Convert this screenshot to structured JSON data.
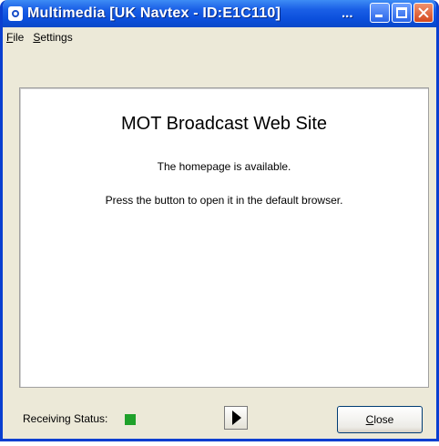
{
  "window": {
    "title": "Multimedia [UK Navtex - ID:E1C110]",
    "title_ellipsis": "..."
  },
  "menu": {
    "file_mnemonic": "F",
    "file_rest": "ile",
    "settings_mnemonic": "S",
    "settings_rest": "ettings"
  },
  "content": {
    "heading": "MOT Broadcast Web Site",
    "message_1": "The homepage is available.",
    "message_2": "Press the button to open it in the default browser."
  },
  "footer": {
    "status_label": "Receiving Status:",
    "status_color": "#1fa12a",
    "close_mnemonic": "C",
    "close_rest": "lose"
  },
  "icons": {
    "app": "app-icon",
    "play": "play-icon",
    "minimize": "minimize-icon",
    "maximize": "maximize-icon",
    "close": "close-icon"
  }
}
